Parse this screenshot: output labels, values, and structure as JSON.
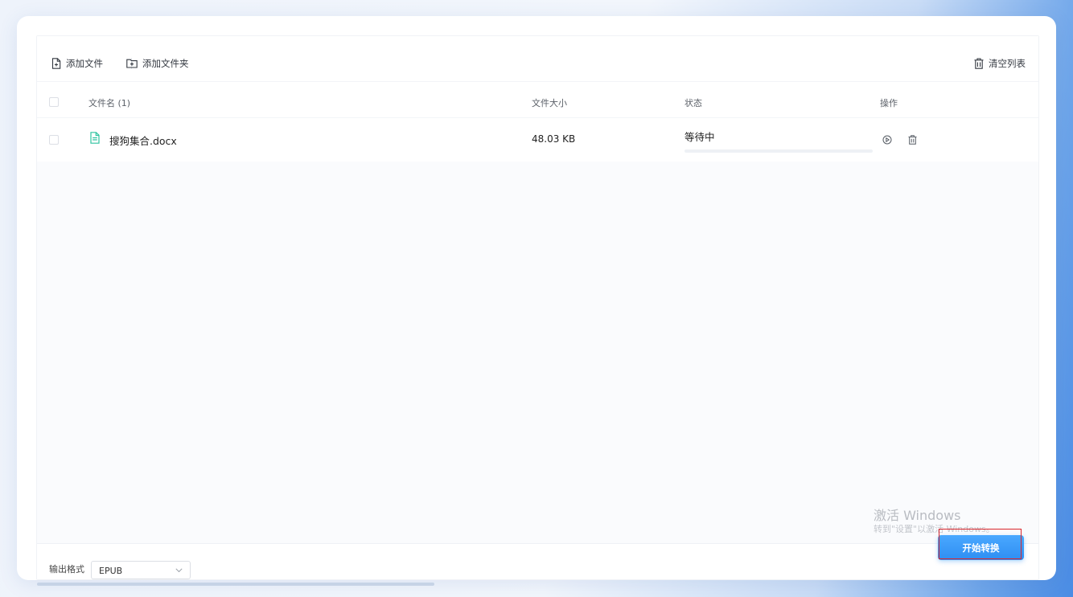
{
  "toolbar": {
    "add_file": "添加文件",
    "add_folder": "添加文件夹",
    "clear_list": "清空列表"
  },
  "table": {
    "columns": {
      "name": "文件名 (1)",
      "size": "文件大小",
      "status": "状态",
      "actions": "操作"
    },
    "rows": [
      {
        "file_name": "搜狗集合.docx",
        "size": "48.03 KB",
        "status": "等待中",
        "progress": 0
      }
    ]
  },
  "footer": {
    "format_label": "输出格式",
    "format_value": "EPUB",
    "start_button": "开始转换"
  },
  "watermark": {
    "line1": "激活 Windows",
    "line2": "转到\"设置\"以激活 Windows。"
  },
  "colors": {
    "accent": "#2e8ef2",
    "file_icon": "#2fc4a0",
    "highlight": "#d9252b"
  },
  "icons": {
    "add_file": "file-plus-icon",
    "add_folder": "folder-plus-icon",
    "clear_list": "trash-icon",
    "file_type": "document-icon",
    "row_start": "play-circle-icon",
    "row_delete": "trash-icon",
    "select_caret": "chevron-down-icon"
  }
}
